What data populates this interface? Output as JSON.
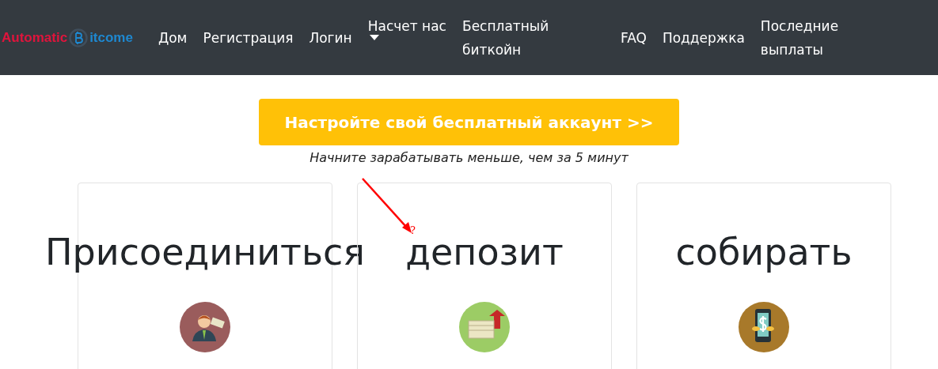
{
  "header": {
    "logo": {
      "left": "Automatic",
      "right": "itcome"
    },
    "nav": [
      {
        "label": "Дом",
        "kind": "link"
      },
      {
        "label": "Регистрация",
        "kind": "link"
      },
      {
        "label": "Логин",
        "kind": "link"
      },
      {
        "label": "Насчет нас",
        "kind": "dropdown"
      },
      {
        "label": "Бесплатный биткойн",
        "kind": "wide"
      },
      {
        "label": "FAQ",
        "kind": "link"
      },
      {
        "label": "Поддержка",
        "kind": "link"
      },
      {
        "label": "Последние выплаты",
        "kind": "wrap"
      }
    ]
  },
  "hero": {
    "button": "Настройте свой бесплатный аккаунт >>",
    "subtitle": "Начните зарабатывать меньше, чем за 5 минут"
  },
  "annotation": {
    "mark": "?"
  },
  "cards": [
    {
      "title": "Присоединиться",
      "kind": "person"
    },
    {
      "title": "депозит",
      "kind": "money"
    },
    {
      "title": "собирать",
      "kind": "phone"
    }
  ]
}
